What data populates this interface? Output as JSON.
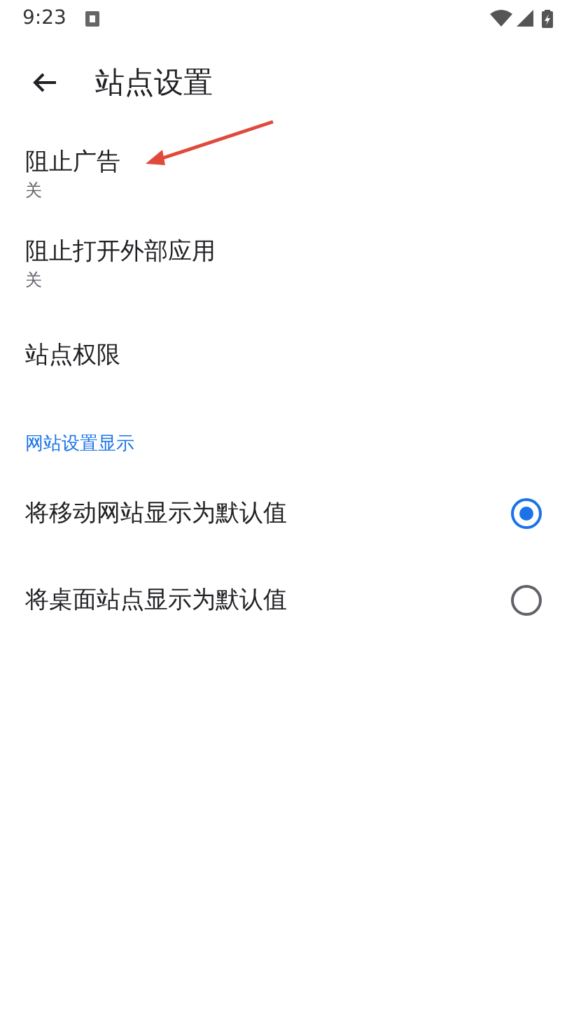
{
  "status_bar": {
    "time": "9:23"
  },
  "toolbar": {
    "title": "站点设置"
  },
  "settings": [
    {
      "title": "阻止广告",
      "summary": "关"
    },
    {
      "title": "阻止打开外部应用",
      "summary": "关"
    },
    {
      "title": "站点权限"
    }
  ],
  "section": {
    "header": "网站设置显示",
    "options": [
      {
        "label": "将移动网站显示为默认值",
        "selected": true
      },
      {
        "label": "将桌面站点显示为默认值",
        "selected": false
      }
    ]
  },
  "annotation": {
    "kind": "arrow"
  }
}
